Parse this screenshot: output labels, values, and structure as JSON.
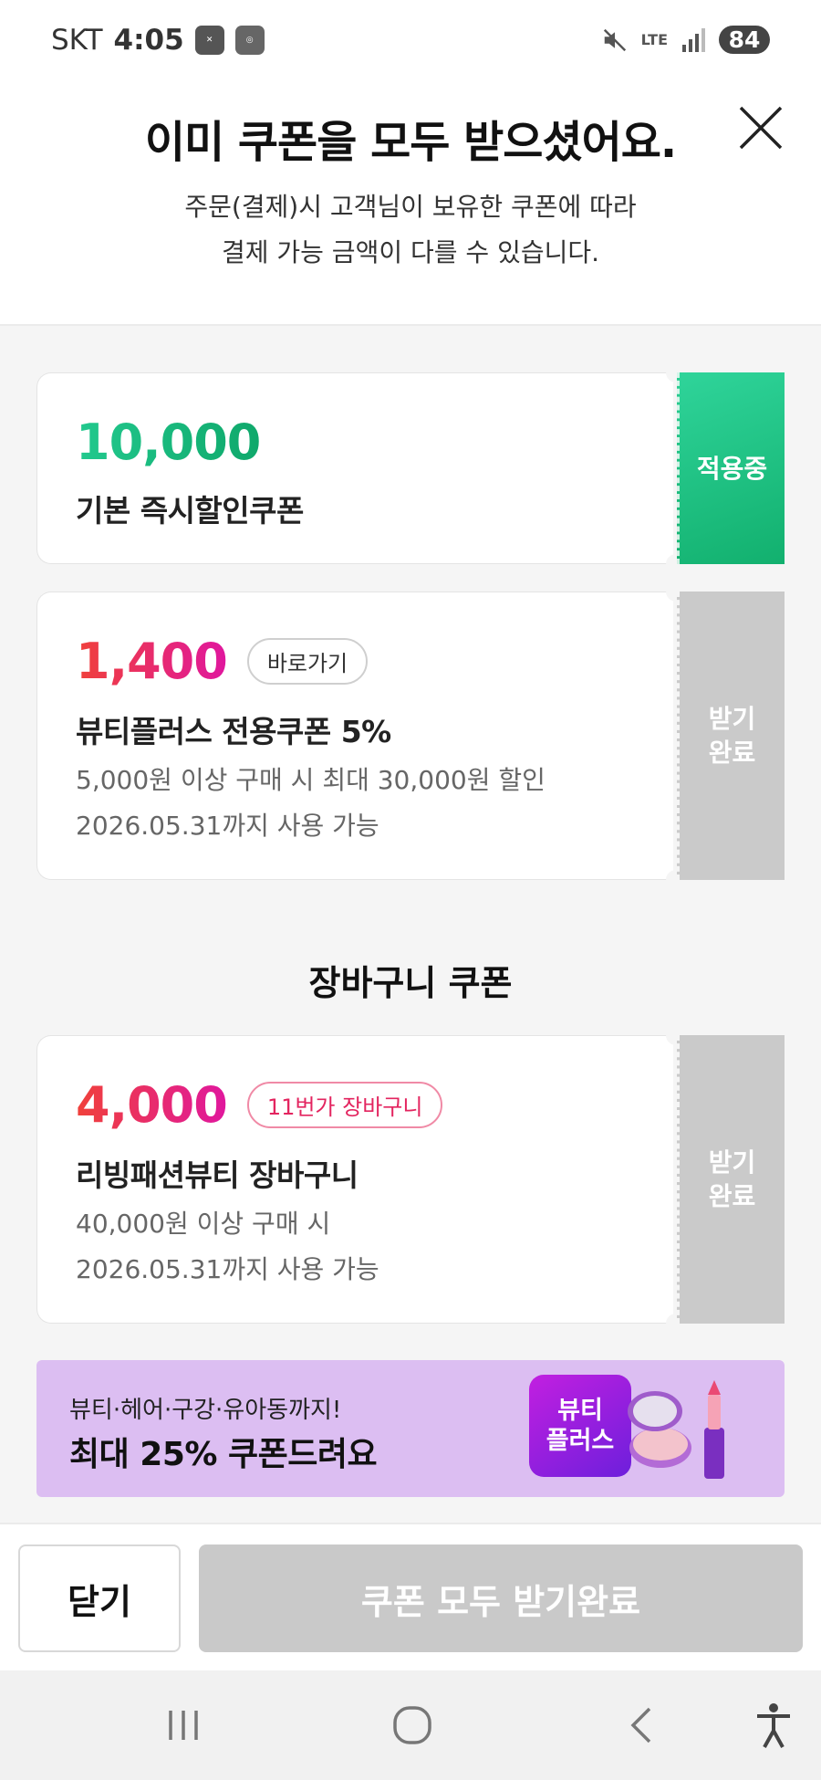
{
  "status_bar": {
    "carrier": "SKT",
    "time": "4:05",
    "network": "LTE",
    "battery": "84"
  },
  "header": {
    "title": "이미 쿠폰을 모두 받으셨어요.",
    "subtitle_line1": "주문(결제)시 고객님이 보유한 쿠폰에 따라",
    "subtitle_line2": "결제 가능 금액이 다를 수 있습니다."
  },
  "coupons": [
    {
      "amount": "10,000",
      "name": "기본 즉시할인쿠폰",
      "stub_label": "적용중",
      "state": "applied",
      "accent": "#1fbf86"
    },
    {
      "amount": "1,400",
      "tag": "바로가기",
      "name": "뷰티플러스 전용쿠폰 5%",
      "desc_line1": "5,000원 이상 구매 시 최대 30,000원 할인",
      "desc_line2": "2026.05.31까지 사용 가능",
      "stub_line1": "받기",
      "stub_line2": "완료",
      "state": "received"
    }
  ],
  "cart_section": {
    "title": "장바구니 쿠폰",
    "coupon": {
      "amount": "4,000",
      "tag": "11번가 장바구니",
      "name": "리빙패션뷰티 장바구니",
      "desc_line1": "40,000원 이상 구매 시",
      "desc_line2": "2026.05.31까지 사용 가능",
      "stub_line1": "받기",
      "stub_line2": "완료",
      "state": "received"
    }
  },
  "banner": {
    "subtitle": "뷰티·헤어·구강·유아동까지!",
    "title": "최대 25% 쿠폰드려요",
    "badge_line1": "뷰티",
    "badge_line2": "플러스",
    "background": "#dcbef2"
  },
  "bottom": {
    "close_label": "닫기",
    "all_received_label": "쿠폰 모두 받기완료"
  },
  "icons": {
    "close": "close-x-icon",
    "nav_recent": "recent-apps-icon",
    "nav_home": "home-icon",
    "nav_back": "back-icon",
    "nav_accessibility": "accessibility-icon"
  }
}
